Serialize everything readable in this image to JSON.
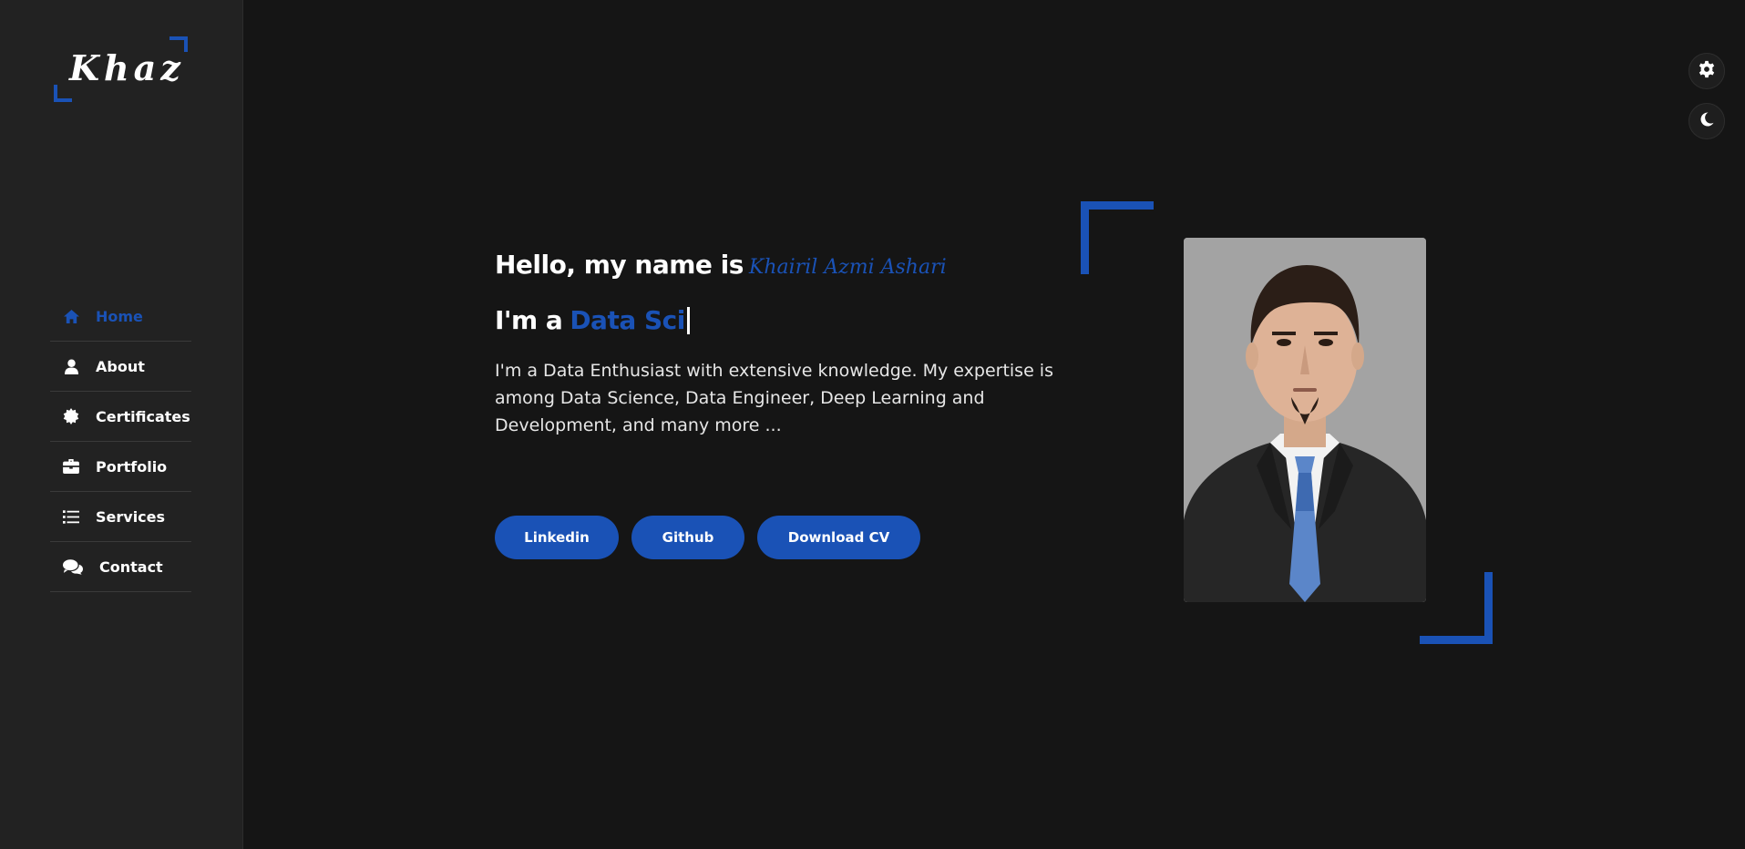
{
  "logo": {
    "text": "Khaz"
  },
  "nav": {
    "items": [
      {
        "label": "Home",
        "icon": "home-icon",
        "active": true
      },
      {
        "label": "About",
        "icon": "user-icon",
        "active": false
      },
      {
        "label": "Certificates",
        "icon": "certificate-icon",
        "active": false
      },
      {
        "label": "Portfolio",
        "icon": "briefcase-icon",
        "active": false
      },
      {
        "label": "Services",
        "icon": "list-icon",
        "active": false
      },
      {
        "label": "Contact",
        "icon": "comments-icon",
        "active": false
      }
    ]
  },
  "toolbar": {
    "settings_icon": "gear-icon",
    "theme_icon": "moon-icon"
  },
  "hero": {
    "greeting": "Hello, my name is",
    "name": "Khairil Azmi Ashari",
    "role_prefix": "I'm a",
    "role_typed": "Data Sci",
    "description": "I'm a Data Enthusiast with extensive knowledge. My expertise is among Data Science, Data Engineer, Deep Learning and Development, and many more ..."
  },
  "buttons": {
    "linkedin": "Linkedin",
    "github": "Github",
    "download_cv": "Download CV"
  },
  "colors": {
    "accent": "#1a52b6",
    "background": "#151515",
    "sidebar": "#222222"
  }
}
